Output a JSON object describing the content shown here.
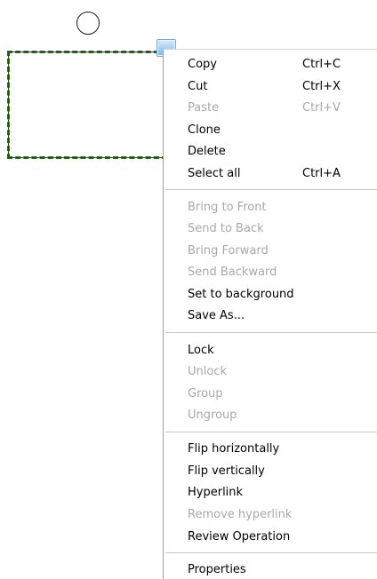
{
  "canvas": {
    "rotate_handle_icon": "circle-outline-icon",
    "resize_handle_icon": "resize-handle-icon",
    "selection_border_color": "#2e6b1f"
  },
  "menu": {
    "items": [
      {
        "label": "Copy",
        "shortcut": "Ctrl+C",
        "enabled": true
      },
      {
        "label": "Cut",
        "shortcut": "Ctrl+X",
        "enabled": true
      },
      {
        "label": "Paste",
        "shortcut": "Ctrl+V",
        "enabled": false
      },
      {
        "label": "Clone",
        "shortcut": "",
        "enabled": true
      },
      {
        "label": "Delete",
        "shortcut": "",
        "enabled": true
      },
      {
        "label": "Select all",
        "shortcut": "Ctrl+A",
        "enabled": true
      },
      {
        "label": "Bring to Front",
        "shortcut": "",
        "enabled": false
      },
      {
        "label": "Send to Back",
        "shortcut": "",
        "enabled": false
      },
      {
        "label": "Bring Forward",
        "shortcut": "",
        "enabled": false
      },
      {
        "label": "Send Backward",
        "shortcut": "",
        "enabled": false
      },
      {
        "label": "Set to background",
        "shortcut": "",
        "enabled": true
      },
      {
        "label": "Save As...",
        "shortcut": "",
        "enabled": true
      },
      {
        "label": "Lock",
        "shortcut": "",
        "enabled": true
      },
      {
        "label": "Unlock",
        "shortcut": "",
        "enabled": false
      },
      {
        "label": "Group",
        "shortcut": "",
        "enabled": false
      },
      {
        "label": "Ungroup",
        "shortcut": "",
        "enabled": false
      },
      {
        "label": "Flip horizontally",
        "shortcut": "",
        "enabled": true
      },
      {
        "label": "Flip vertically",
        "shortcut": "",
        "enabled": true
      },
      {
        "label": "Hyperlink",
        "shortcut": "",
        "enabled": true
      },
      {
        "label": "Remove hyperlink",
        "shortcut": "",
        "enabled": false
      },
      {
        "label": "Review Operation",
        "shortcut": "",
        "enabled": true
      },
      {
        "label": "Properties",
        "shortcut": "",
        "enabled": true
      }
    ],
    "enabled_color": "#000000",
    "disabled_color": "#a8a8a8"
  }
}
